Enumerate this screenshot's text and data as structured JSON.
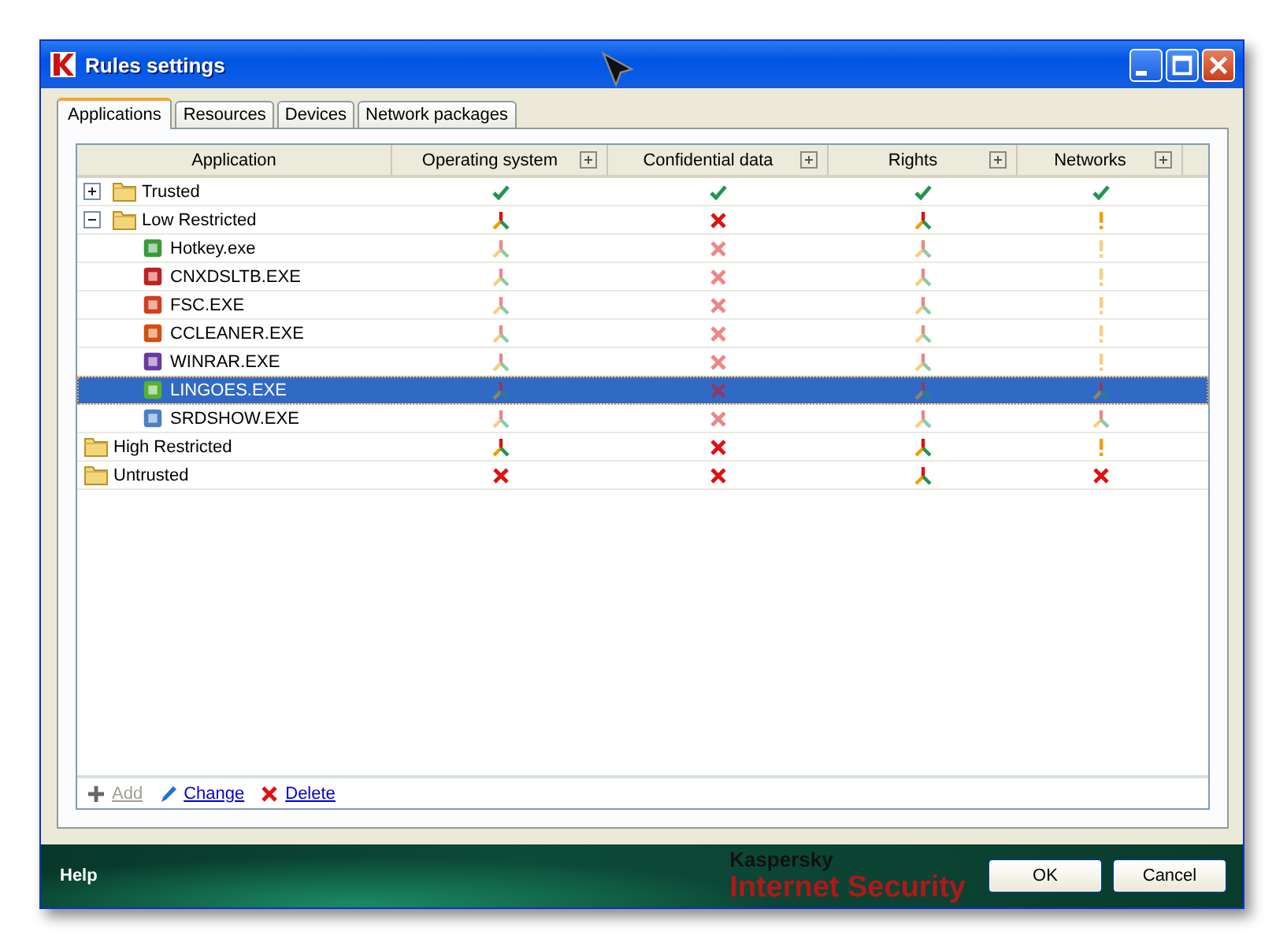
{
  "window": {
    "title": "Rules settings"
  },
  "tabs": [
    {
      "label": "Applications",
      "selected": true
    },
    {
      "label": "Resources",
      "selected": false
    },
    {
      "label": "Devices",
      "selected": false
    },
    {
      "label": "Network packages",
      "selected": false
    }
  ],
  "table": {
    "columns": [
      {
        "label": "Application",
        "expandable": false
      },
      {
        "label": "Operating system",
        "expandable": true
      },
      {
        "label": "Confidential data",
        "expandable": true
      },
      {
        "label": "Rights",
        "expandable": true
      },
      {
        "label": "Networks",
        "expandable": true
      }
    ],
    "rows": [
      {
        "name": "Trusted",
        "kind": "group",
        "expanded": false,
        "selected": false,
        "cells": [
          {
            "kind": "allow",
            "inherited": false
          },
          {
            "kind": "allow",
            "inherited": false
          },
          {
            "kind": "allow",
            "inherited": false
          },
          {
            "kind": "allow",
            "inherited": false
          }
        ]
      },
      {
        "name": "Low Restricted",
        "kind": "group",
        "expanded": true,
        "selected": false,
        "cells": [
          {
            "kind": "mixed",
            "inherited": false
          },
          {
            "kind": "deny",
            "inherited": false
          },
          {
            "kind": "mixed",
            "inherited": false
          },
          {
            "kind": "ask",
            "inherited": false
          }
        ],
        "children": [
          {
            "name": "Hotkey.exe",
            "kind": "app",
            "selected": false,
            "cells": [
              {
                "kind": "mixed",
                "inherited": true
              },
              {
                "kind": "deny",
                "inherited": true
              },
              {
                "kind": "mixed",
                "inherited": true
              },
              {
                "kind": "ask",
                "inherited": true
              }
            ]
          },
          {
            "name": "CNXDSLTB.EXE",
            "kind": "app",
            "selected": false,
            "cells": [
              {
                "kind": "mixed",
                "inherited": true
              },
              {
                "kind": "deny",
                "inherited": true
              },
              {
                "kind": "mixed",
                "inherited": true
              },
              {
                "kind": "ask",
                "inherited": true
              }
            ]
          },
          {
            "name": "FSC.EXE",
            "kind": "app",
            "selected": false,
            "cells": [
              {
                "kind": "mixed",
                "inherited": true
              },
              {
                "kind": "deny",
                "inherited": true
              },
              {
                "kind": "mixed",
                "inherited": true
              },
              {
                "kind": "ask",
                "inherited": true
              }
            ]
          },
          {
            "name": "CCLEANER.EXE",
            "kind": "app",
            "selected": false,
            "cells": [
              {
                "kind": "mixed",
                "inherited": true
              },
              {
                "kind": "deny",
                "inherited": true
              },
              {
                "kind": "mixed",
                "inherited": true
              },
              {
                "kind": "ask",
                "inherited": true
              }
            ]
          },
          {
            "name": "WINRAR.EXE",
            "kind": "app",
            "selected": false,
            "cells": [
              {
                "kind": "mixed",
                "inherited": true
              },
              {
                "kind": "deny",
                "inherited": true
              },
              {
                "kind": "mixed",
                "inherited": true
              },
              {
                "kind": "ask",
                "inherited": true
              }
            ]
          },
          {
            "name": "LINGOES.EXE",
            "kind": "app",
            "selected": true,
            "cells": [
              {
                "kind": "mixed",
                "inherited": true
              },
              {
                "kind": "deny",
                "inherited": true
              },
              {
                "kind": "mixed",
                "inherited": true
              },
              {
                "kind": "mixed",
                "inherited": true
              }
            ]
          },
          {
            "name": "SRDSHOW.EXE",
            "kind": "app",
            "selected": false,
            "cells": [
              {
                "kind": "mixed",
                "inherited": true
              },
              {
                "kind": "deny",
                "inherited": true
              },
              {
                "kind": "mixed",
                "inherited": true
              },
              {
                "kind": "mixed",
                "inherited": true
              }
            ]
          }
        ]
      },
      {
        "name": "High Restricted",
        "kind": "group",
        "selected": false,
        "cells": [
          {
            "kind": "mixed",
            "inherited": false
          },
          {
            "kind": "deny",
            "inherited": false
          },
          {
            "kind": "mixed",
            "inherited": false
          },
          {
            "kind": "ask",
            "inherited": false
          }
        ]
      },
      {
        "name": "Untrusted",
        "kind": "group",
        "selected": false,
        "cells": [
          {
            "kind": "deny",
            "inherited": false
          },
          {
            "kind": "deny",
            "inherited": false
          },
          {
            "kind": "mixed",
            "inherited": false
          },
          {
            "kind": "deny",
            "inherited": false
          }
        ]
      }
    ]
  },
  "actions": [
    {
      "label": "Add",
      "kind": "add",
      "disabled": true
    },
    {
      "label": "Change",
      "kind": "edit",
      "disabled": false
    },
    {
      "label": "Delete",
      "kind": "delete",
      "disabled": false
    }
  ],
  "footer": {
    "help": "Help",
    "brand": "Kaspersky",
    "product": "Internet Security"
  },
  "buttons": [
    "OK",
    "Cancel"
  ]
}
